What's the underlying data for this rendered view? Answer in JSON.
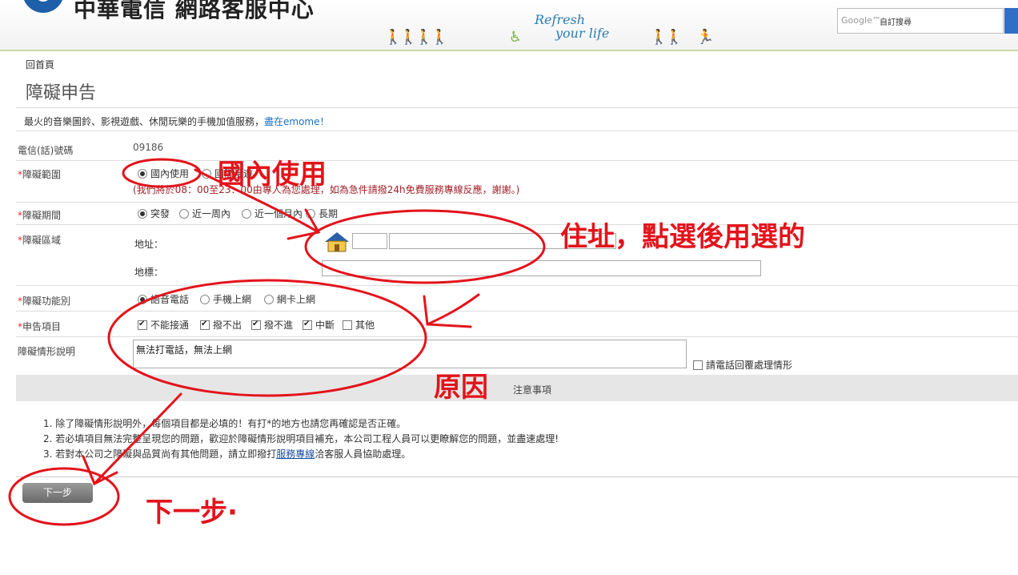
{
  "header": {
    "logo_text": "中華電信  網路客服中心",
    "refresh_line1": "Refresh",
    "refresh_line2": "your life",
    "search_brand": "Google™",
    "search_placeholder": "自訂搜尋"
  },
  "breadcrumb": "回首頁",
  "page_title": "障礙申告",
  "promo": {
    "text": "最火的音樂圖鈴、影視遊戲、休閒玩樂的手機加值服務，",
    "link": "盡在emome！"
  },
  "form": {
    "phone": {
      "label": "電信(話)號碼",
      "value": "09186"
    },
    "scope": {
      "label": "障礙範圍",
      "options": [
        "國內使用",
        "國際漫遊"
      ],
      "selected": "國內使用",
      "notice": "(我們將於08：00至23：00由專人為您處理，如為急件請撥24h免費服務專線反應，謝謝。)"
    },
    "period": {
      "label": "障礙期間",
      "options": [
        "突發",
        "近一周內",
        "近一個月內",
        "長期"
      ],
      "selected": "突發"
    },
    "area": {
      "label": "障礙區域",
      "address_label": "地址：",
      "landmark_label": "地標："
    },
    "function": {
      "label": "障礙功能別",
      "options": [
        "語音電話",
        "手機上網",
        "網卡上網"
      ],
      "selected": "語音電話"
    },
    "items": {
      "label": "申告項目",
      "options": [
        {
          "label": "不能接通",
          "checked": true
        },
        {
          "label": "撥不出",
          "checked": true
        },
        {
          "label": "撥不進",
          "checked": true
        },
        {
          "label": "中斷",
          "checked": true
        },
        {
          "label": "其他",
          "checked": false
        }
      ]
    },
    "description": {
      "label": "障礙情形說明",
      "value": "無法打電話，無法上網",
      "callback_label": "請電話回覆處理情形",
      "callback_checked": false
    },
    "required_mark": "*"
  },
  "notice": {
    "title": "注意事項",
    "items": [
      "1. 除了障礙情形說明外，每個項目都是必填的！有打*的地方也請您再確認是否正確。",
      "2. 若必填項目無法完整呈現您的問題，歡迎於障礙情形說明項目補充，本公司工程人員可以更瞭解您的問題，並盡速處理!"
    ],
    "item3_prefix": "3. 若對本公司之障礙與品質尚有其他問題，請立即撥打",
    "item3_link": "服務專線",
    "item3_suffix": "洽客服人員協助處理。"
  },
  "next_button": "下一步",
  "annotations": {
    "domestic": "國內使用",
    "address": "住址，點選後用選的",
    "reason": "原因",
    "next": "下一步·"
  },
  "colors": {
    "annotation": "#e3131b",
    "required": "#dd3333",
    "link": "#1a73c6"
  }
}
